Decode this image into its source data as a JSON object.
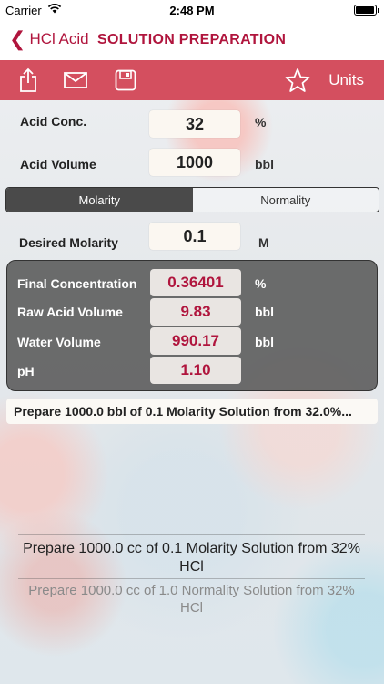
{
  "status_bar": {
    "carrier": "Carrier",
    "time": "2:48 PM"
  },
  "nav": {
    "back_label": "HCl Acid",
    "title": "SOLUTION PREPARATION",
    "accent_color": "#b0153d"
  },
  "toolbar": {
    "background_color": "#d44f5f",
    "icons": [
      "share-icon",
      "mail-icon",
      "save-icon",
      "star-icon"
    ],
    "units_label": "Units"
  },
  "inputs": {
    "acid_conc": {
      "label": "Acid Conc.",
      "value": "32",
      "unit": "%"
    },
    "acid_volume": {
      "label": "Acid Volume",
      "value": "1000",
      "unit": "bbl"
    },
    "desired_molarity": {
      "label": "Desired Molarity",
      "value": "0.1",
      "unit": "M"
    }
  },
  "segment": {
    "options": [
      "Molarity",
      "Normality"
    ],
    "selected": "Molarity"
  },
  "results": {
    "final_concentration": {
      "label": "Final Concentration",
      "value": "0.36401",
      "unit": "%"
    },
    "raw_acid_volume": {
      "label": "Raw Acid Volume",
      "value": "9.83",
      "unit": "bbl"
    },
    "water_volume": {
      "label": "Water Volume",
      "value": "990.17",
      "unit": "bbl"
    },
    "ph": {
      "label": "pH",
      "value": "1.10"
    }
  },
  "summary": "Prepare 1000.0 bbl of 0.1 Molarity Solution from 32.0%...",
  "history": [
    "Prepare 1000.0 cc of 0.1 Molarity Solution from 32% HCl",
    "Prepare 1000.0 cc of 1.0 Normality Solution from 32% HCl"
  ]
}
